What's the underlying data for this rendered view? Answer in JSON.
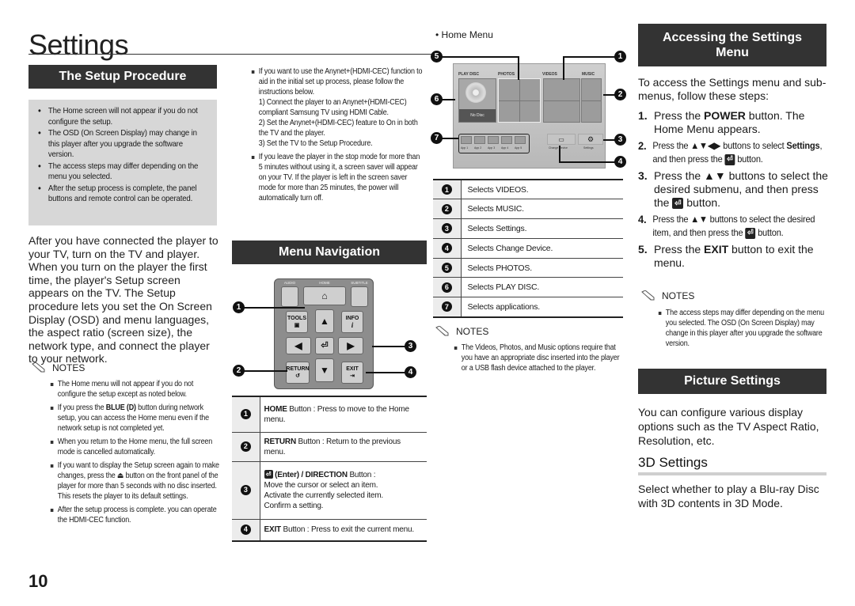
{
  "page": {
    "title": "Settings",
    "number": "10"
  },
  "setup_procedure": {
    "heading": "The Setup Procedure",
    "box_notes": [
      "The Home screen will not appear if you do not configure the setup.",
      "The OSD (On Screen Display) may change in this player after you upgrade the software version.",
      "The access steps may differ depending on the menu you selected.",
      "After the setup process is complete, the panel buttons and remote control can be operated."
    ],
    "intro": "After you have connected the player to your TV, turn on the TV and player. When you turn on the player the first time, the player's Setup screen appears on the TV. The Setup procedure lets you set the On Screen Display (OSD) and menu languages, the aspect ratio (screen size), the network type, and connect the player to your network.",
    "notes_label": "NOTES",
    "notes": [
      {
        "text": "The Home menu will not appear if you do not configure the setup except as noted below."
      },
      {
        "pre": "If you press the ",
        "bold": "BLUE (D)",
        "post": " button during network setup, you can access the Home menu even if the network setup is not completed yet."
      },
      {
        "text": "When you return to the Home menu, the full screen mode is cancelled automatically."
      },
      {
        "pre": "If you want to display the Setup screen again to make changes, press the ",
        "bold": "⏏",
        "post": " button on the front panel of the player for more than 5 seconds with no disc inserted. This resets the player to its default settings."
      },
      {
        "text": "After the setup process is complete. you can operate the HDMI-CEC function."
      }
    ],
    "anynet_notes": [
      "If you want to use the Anynet+(HDMI-CEC) function to aid in the initial set up process, please follow the instructions below.",
      "1) Connect the player to an Anynet+(HDMI-CEC) compliant Samsung TV using HDMI Cable.",
      "2) Set the Anynet+(HDMI-CEC) feature to On in both the TV and the player.",
      "3) Set the TV to the Setup Procedure.",
      "If you leave the player in the stop mode for more than 5 minutes without using it, a screen saver will appear on your TV. If the player is left in the screen saver mode for more than 25 minutes, the power will automatically turn off."
    ]
  },
  "menu_navigation": {
    "heading": "Menu Navigation",
    "remote": {
      "audio": "AUDIO",
      "home": "HOME",
      "subtitle": "SUBTITLE",
      "tools": "TOOLS",
      "info": "INFO",
      "return": "RETURN",
      "exit": "EXIT",
      "up": "▲",
      "down": "▼",
      "left": "◀",
      "right": "▶"
    },
    "callouts": [
      "1",
      "2",
      "3",
      "4"
    ],
    "rows": [
      {
        "num": "1",
        "bold": "HOME",
        "text": " Button : Press to move to the Home menu."
      },
      {
        "num": "2",
        "bold": "RETURN",
        "text": " Button : Return to the previous menu."
      },
      {
        "num": "3",
        "bold": "(Enter) / DIRECTION",
        "text": " Button :",
        "lines": [
          "Move the cursor or select an item.",
          "Activate the currently selected item.",
          "Confirm a setting."
        ]
      },
      {
        "num": "4",
        "bold": "EXIT",
        "text": " Button : Press to exit the current menu."
      }
    ]
  },
  "home_menu": {
    "label": "Home Menu",
    "screen": {
      "play_disc": "PLAY DISC",
      "photos": "PHOTOS",
      "videos": "VIDEOS",
      "music": "MUSIC",
      "no_disc": "No Disc",
      "apps": [
        "App 1",
        "App 2",
        "App 3",
        "App 4",
        "App 5"
      ],
      "change_device": "Change Device",
      "settings": "Settings"
    },
    "callouts": [
      "1",
      "2",
      "3",
      "4",
      "5",
      "6",
      "7"
    ],
    "rows": [
      {
        "num": "1",
        "text": "Selects VIDEOS."
      },
      {
        "num": "2",
        "text": "Selects MUSIC."
      },
      {
        "num": "3",
        "text": "Selects Settings."
      },
      {
        "num": "4",
        "text": "Selects Change Device."
      },
      {
        "num": "5",
        "text": "Selects PHOTOS."
      },
      {
        "num": "6",
        "text": "Selects PLAY DISC."
      },
      {
        "num": "7",
        "text": "Selects applications."
      }
    ],
    "notes_label": "NOTES",
    "notes": [
      "The Videos, Photos, and Music options require that you have an appropriate disc inserted into the player or a USB flash device attached to the player."
    ]
  },
  "accessing_settings": {
    "heading": "Accessing the Settings Menu",
    "intro": "To access the Settings menu and sub-menus, follow these steps:",
    "steps": [
      {
        "n": "1.",
        "pre": "Press the ",
        "bold": "POWER",
        "post": " button. The Home Menu appears."
      },
      {
        "n": "2.",
        "pre": "Press the ▲▼◀▶ buttons to select ",
        "bold": "Settings",
        "post": ", and then press the [enter] button."
      },
      {
        "n": "3.",
        "pre": "Press the ▲▼ buttons to select the desired submenu, and then press the [enter] button.",
        "bold": "",
        "post": ""
      },
      {
        "n": "4.",
        "pre": "Press the ▲▼ buttons to select the desired item, and then press the [enter] button.",
        "bold": "",
        "post": ""
      },
      {
        "n": "5.",
        "pre": "Press the ",
        "bold": "EXIT",
        "post": " button to exit the menu."
      }
    ],
    "notes_label": "NOTES",
    "notes": [
      "The access steps may differ depending on the menu you selected. The OSD (On Screen Display) may change in this player after you upgrade the software version."
    ]
  },
  "picture_settings": {
    "heading": "Picture Settings",
    "intro": "You can configure various display options such as the TV Aspect Ratio, Resolution, etc.",
    "sub_heading": "3D Settings",
    "sub_text": "Select whether to play a Blu-ray Disc with 3D contents in 3D Mode."
  }
}
